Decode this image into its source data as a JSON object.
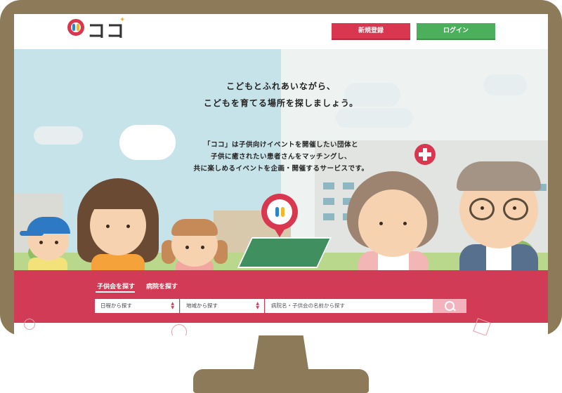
{
  "brand": {
    "name": "ココ",
    "primary_color": "#d23b55",
    "login_color": "#4caf5b"
  },
  "header": {
    "register_label": "新規登録",
    "login_label": "ログイン"
  },
  "hero": {
    "tagline_line1": "こどもとふれあいながら、",
    "tagline_line2": "こどもを育てる場所を探しましょう。",
    "desc_line1": "「ココ」は子供向けイベントを開催したい団体と",
    "desc_line2": "子供に癒されたい患者さんをマッチングし、",
    "desc_line3": "共に楽しめるイベントを企画・開催するサービスです。"
  },
  "search": {
    "tabs": [
      {
        "label": "子供会を探す",
        "active": true
      },
      {
        "label": "病院を探す",
        "active": false
      }
    ],
    "date_select": "日程から探す",
    "area_select": "地域から探す",
    "name_placeholder": "病院名・子供会の名前から探す",
    "button_icon": "search-icon"
  }
}
